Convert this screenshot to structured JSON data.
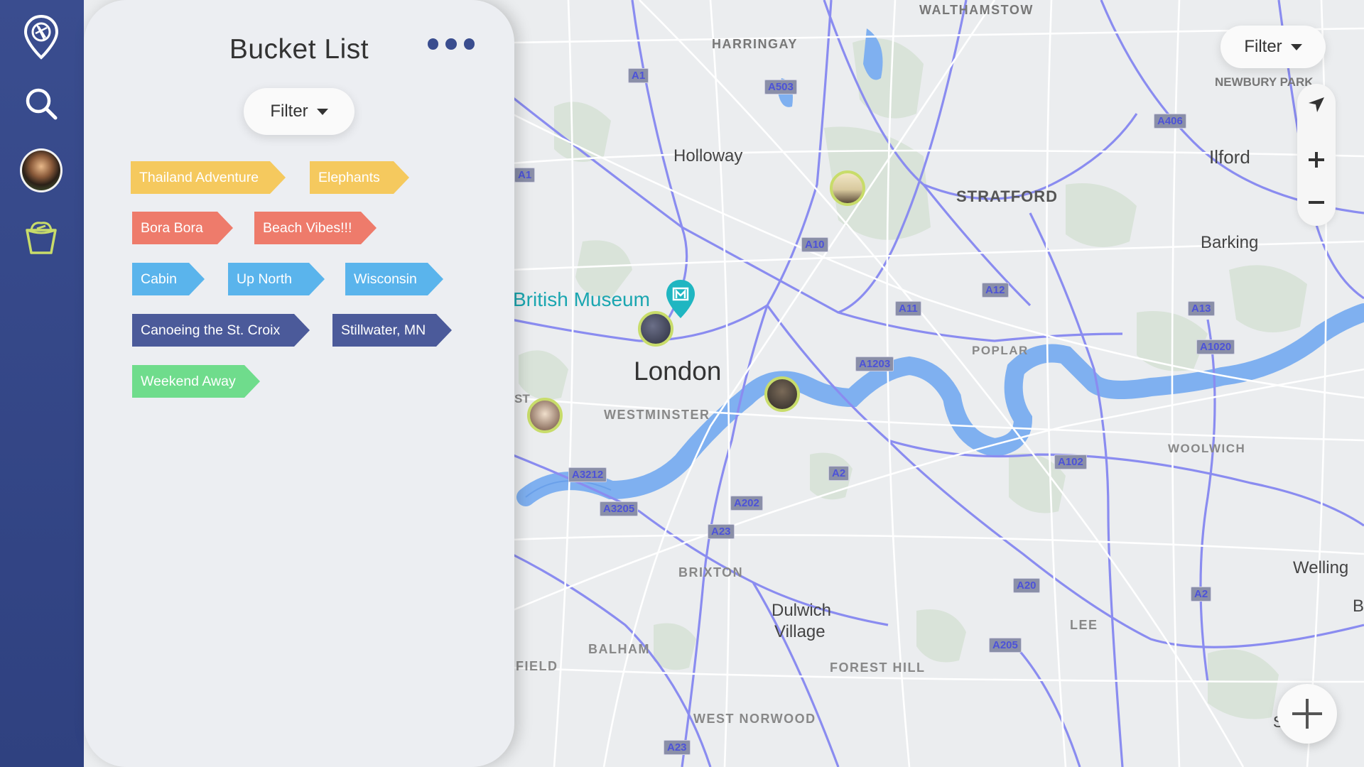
{
  "app": {
    "accent": "#3a4d8f",
    "sidebar_icons": [
      "camera-pin-icon",
      "search-icon",
      "avatar",
      "bucket-icon"
    ]
  },
  "panel": {
    "title": "Bucket List",
    "filter_label": "Filter",
    "tags": [
      {
        "label": "Thailand Adventure",
        "color": "#f5c95e"
      },
      {
        "label": "Elephants",
        "color": "#f5c95e"
      },
      {
        "label": "Bora Bora",
        "color": "#ee7b6b"
      },
      {
        "label": "Beach Vibes!!!",
        "color": "#ee7b6b"
      },
      {
        "label": "Cabin",
        "color": "#5ab4ec"
      },
      {
        "label": "Up North",
        "color": "#5ab4ec"
      },
      {
        "label": "Wisconsin",
        "color": "#5ab4ec"
      },
      {
        "label": "Canoeing the St. Croix",
        "color": "#4b5a9a"
      },
      {
        "label": "Stillwater, MN",
        "color": "#4b5a9a"
      },
      {
        "label": "Weekend Away",
        "color": "#6fdc8c"
      }
    ]
  },
  "map": {
    "filter_label": "Filter",
    "places": {
      "walthamstow": "WALTHAMSTOW",
      "harringay": "HARRINGAY",
      "newbury_park": "NEWBURY PARK",
      "holloway": "Holloway",
      "ilford": "Ilford",
      "stratford": "STRATFORD",
      "barking": "Barking",
      "british_museum": "British Museum",
      "poplar": "POPLAR",
      "london": "London",
      "westminster": "WESTMINSTER",
      "woolwich": "WOOLWICH",
      "brixton": "BRIXTON",
      "welling": "Welling",
      "dulwich_1": "Dulwich",
      "dulwich_2": "Village",
      "lee": "LEE",
      "balham": "BALHAM",
      "field": "FIELD",
      "forest_hill": "FOREST HILL",
      "west_norwood": "WEST NORWOOD",
      "edge_b": "B",
      "edge_s": "S",
      "edge_st": "ST"
    },
    "roads": [
      "A1",
      "A503",
      "A406",
      "A1",
      "A10",
      "A12",
      "A11",
      "A13",
      "A1203",
      "A1020",
      "A102",
      "A3212",
      "A2",
      "A3205",
      "A202",
      "A23",
      "A20",
      "A2",
      "A205",
      "A23"
    ]
  }
}
